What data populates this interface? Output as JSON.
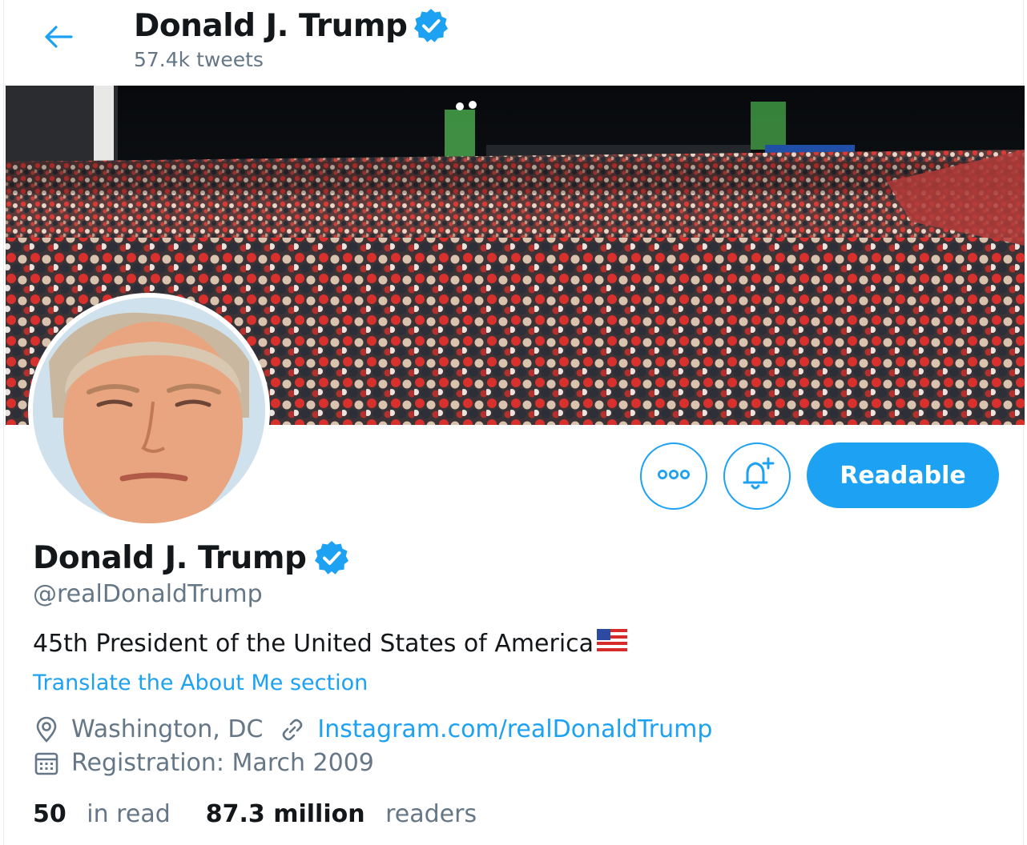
{
  "header": {
    "title": "Donald J. Trump",
    "tweet_count": "57.4k tweets"
  },
  "profile": {
    "name": "Donald J. Trump",
    "handle": "@realDonaldTrump",
    "bio": "45th President of the United States of America",
    "translate_link": "Translate the About Me section",
    "location": "Washington, DC",
    "website": "Instagram.com/realDonaldTrump",
    "joined": "Registration: March 2009"
  },
  "actions": {
    "follow_label": "Readable"
  },
  "stats": {
    "following_count": "50",
    "following_label": "in read",
    "followers_count": "87.3 million",
    "followers_label": "readers"
  },
  "icons": {
    "back": "arrow-left-icon",
    "verified": "verified-badge-icon",
    "more": "more-horizontal-icon",
    "notify": "bell-plus-icon",
    "location": "location-pin-icon",
    "link": "link-icon",
    "calendar": "calendar-icon",
    "flag": "us-flag-emoji"
  },
  "colors": {
    "accent": "#1da1f2",
    "text_primary": "#14171a",
    "text_secondary": "#657786"
  }
}
